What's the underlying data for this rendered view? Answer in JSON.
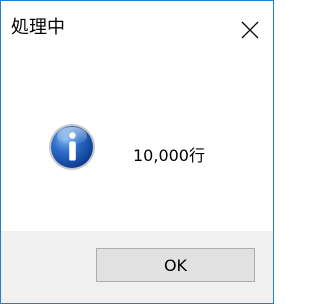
{
  "window": {
    "title": "処理中",
    "close_icon": "close-icon",
    "accent_border": "#1b7fd6"
  },
  "dialog": {
    "icon": "information-icon",
    "message": "10,000行"
  },
  "footer": {
    "ok_label": "OK"
  }
}
